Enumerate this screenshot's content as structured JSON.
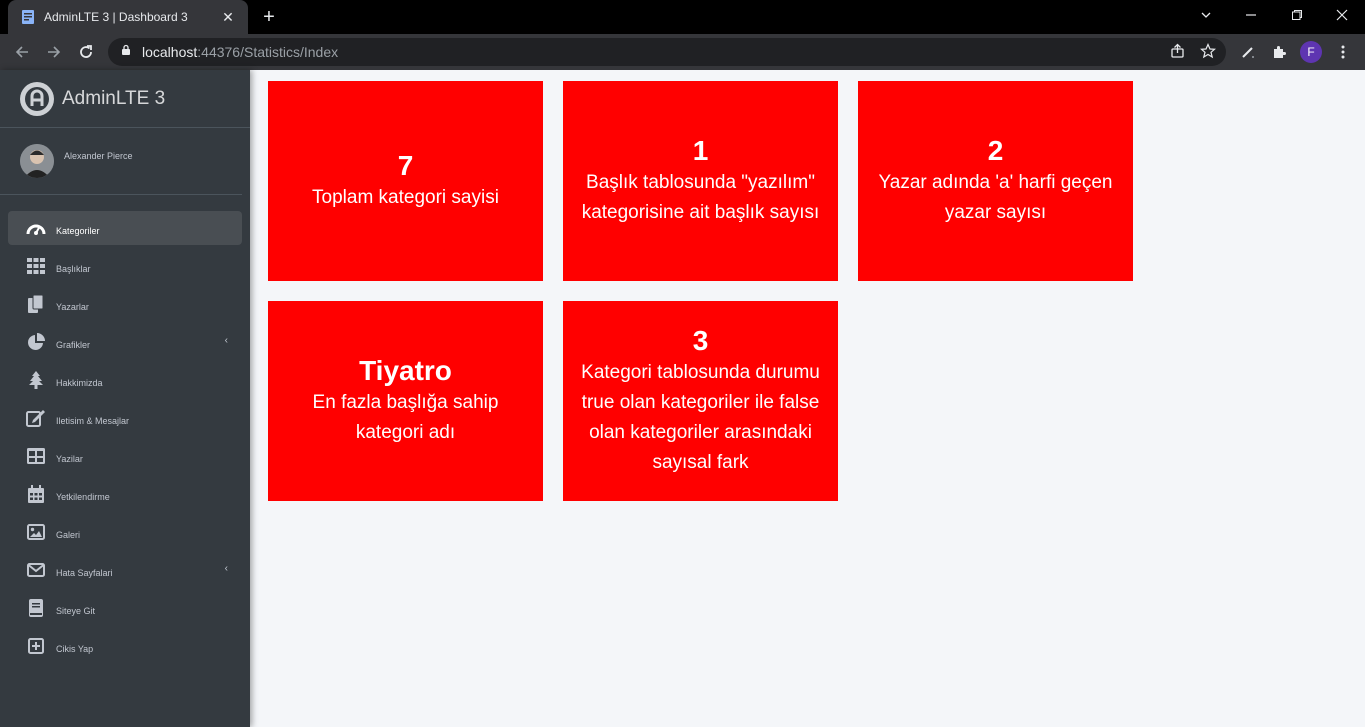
{
  "browser": {
    "tab_title": "AdminLTE 3 | Dashboard 3",
    "url_host": "localhost",
    "url_rest": ":44376/Statistics/Index",
    "profile_initial": "F"
  },
  "sidebar": {
    "brand": "AdminLTE 3",
    "user_name": "Alexander Pierce",
    "items": [
      {
        "label": "Kategoriler",
        "icon": "tachometer-icon"
      },
      {
        "label": "Başlıklar",
        "icon": "th-grid-icon"
      },
      {
        "label": "Yazarlar",
        "icon": "copy-icon"
      },
      {
        "label": "Grafikler",
        "icon": "chart-pie-icon"
      },
      {
        "label": "Hakkimizda",
        "icon": "tree-icon"
      },
      {
        "label": "Iletisim & Mesajlar",
        "icon": "edit-icon"
      },
      {
        "label": "Yazilar",
        "icon": "table-icon"
      },
      {
        "label": "Yetkilendirme",
        "icon": "calendar-icon"
      },
      {
        "label": "Galeri",
        "icon": "image-icon"
      },
      {
        "label": "Hata Sayfalari",
        "icon": "envelope-icon"
      },
      {
        "label": "Siteye Git",
        "icon": "book-icon"
      },
      {
        "label": "Cikis Yap",
        "icon": "plus-square-icon"
      }
    ]
  },
  "cards": [
    {
      "value": "7",
      "text": "Toplam kategori sayisi"
    },
    {
      "value": "1",
      "text": "Başlık tablosunda \"yazılım\" kategorisine ait başlık sayısı"
    },
    {
      "value": "2",
      "text": "Yazar adında 'a' harfi geçen yazar sayısı"
    },
    {
      "value": "Tiyatro",
      "text": "En fazla başlığa sahip kategori adı"
    },
    {
      "value": "3",
      "text": "Kategori tablosunda durumu true olan kategoriler ile false olan kategoriler arasındaki sayısal fark"
    }
  ],
  "colors": {
    "card_bg": "#ff0000",
    "sidebar_bg": "#343a40",
    "content_bg": "#f4f6f9"
  }
}
